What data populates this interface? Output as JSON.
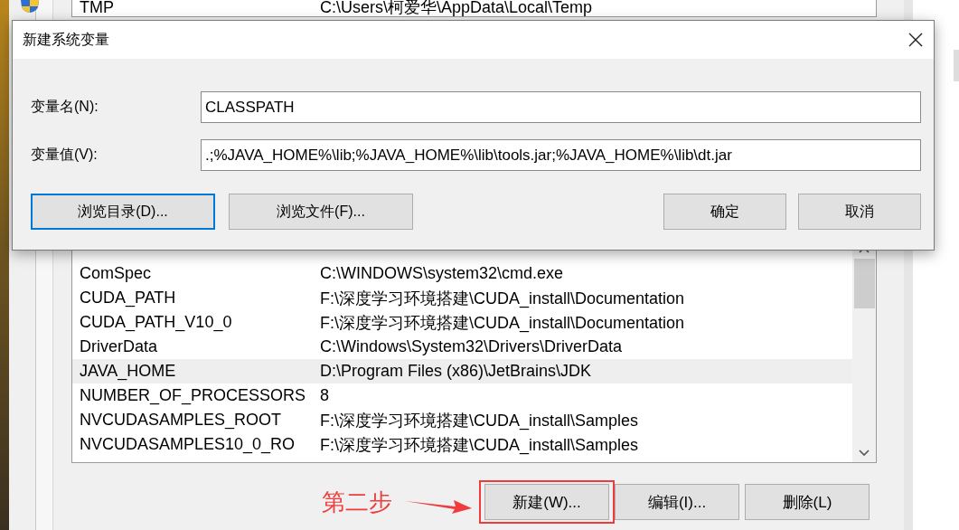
{
  "background_window": {
    "user_variables": [
      {
        "name": "TMP",
        "value": "C:\\Users\\柯爱华\\AppData\\Local\\Temp"
      }
    ],
    "system_variables": {
      "rows": [
        {
          "name": "ComSpec",
          "value": "C:\\WINDOWS\\system32\\cmd.exe",
          "selected": false
        },
        {
          "name": "CUDA_PATH",
          "value": "F:\\深度学习环境搭建\\CUDA_install\\Documentation",
          "selected": false
        },
        {
          "name": "CUDA_PATH_V10_0",
          "value": "F:\\深度学习环境搭建\\CUDA_install\\Documentation",
          "selected": false
        },
        {
          "name": "DriverData",
          "value": "C:\\Windows\\System32\\Drivers\\DriverData",
          "selected": false
        },
        {
          "name": "JAVA_HOME",
          "value": "D:\\Program Files (x86)\\JetBrains\\JDK",
          "selected": true
        },
        {
          "name": "NUMBER_OF_PROCESSORS",
          "value": "8",
          "selected": false
        },
        {
          "name": "NVCUDASAMPLES_ROOT",
          "value": "F:\\深度学习环境搭建\\CUDA_install\\Samples",
          "selected": false
        },
        {
          "name": "NVCUDASAMPLES10_0_RO",
          "value": "F:\\深度学习环境搭建\\CUDA_install\\Samples",
          "selected": false
        }
      ]
    },
    "buttons": [
      {
        "label": "新建(W)...",
        "highlighted": true
      },
      {
        "label": "编辑(I)...",
        "highlighted": false
      },
      {
        "label": "删除(L)",
        "highlighted": false
      }
    ]
  },
  "annotation": {
    "text": "第二步"
  },
  "dialog": {
    "title": "新建系统变量",
    "fields": [
      {
        "label": "变量名(N):",
        "value": "CLASSPATH"
      },
      {
        "label": "变量值(V):",
        "value": ".;%JAVA_HOME%\\lib;%JAVA_HOME%\\lib\\tools.jar;%JAVA_HOME%\\lib\\dt.jar"
      }
    ],
    "buttons": [
      {
        "label": "浏览目录(D)...",
        "focused": true
      },
      {
        "label": "浏览文件(F)...",
        "focused": false
      },
      {
        "label": "确定",
        "focused": false
      },
      {
        "label": "取消",
        "focused": false
      }
    ]
  }
}
